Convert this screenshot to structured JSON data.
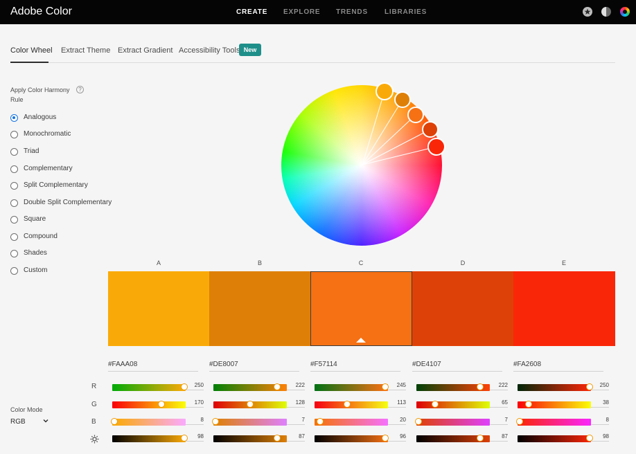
{
  "app": {
    "title": "Adobe Color"
  },
  "nav": {
    "create": "CREATE",
    "explore": "EXPLORE",
    "trends": "TRENDS",
    "libraries": "LIBRARIES"
  },
  "header_icons": [
    "profile-star-icon",
    "contrast-icon",
    "color-wheel-icon"
  ],
  "tabs": [
    {
      "label": "Color Wheel",
      "active": true
    },
    {
      "label": "Extract Theme",
      "active": false
    },
    {
      "label": "Extract Gradient",
      "active": false
    },
    {
      "label": "Accessibility Tools",
      "active": false
    }
  ],
  "new_badge": "New",
  "harmony": {
    "title": "Apply Color Harmony Rule",
    "help": "?",
    "selected": "Analogous",
    "rules": [
      "Analogous",
      "Monochromatic",
      "Triad",
      "Complementary",
      "Split Complementary",
      "Double Split Complementary",
      "Square",
      "Compound",
      "Shades",
      "Custom"
    ]
  },
  "swatches": [
    {
      "letter": "A",
      "hex": "#FAAA08",
      "color": "#faaa08",
      "r": 250,
      "g": 170,
      "b": 8,
      "brightness": 98
    },
    {
      "letter": "B",
      "hex": "#DE8007",
      "color": "#de8007",
      "r": 222,
      "g": 128,
      "b": 7,
      "brightness": 87
    },
    {
      "letter": "C",
      "hex": "#F57114",
      "color": "#f57114",
      "r": 245,
      "g": 113,
      "b": 20,
      "brightness": 96,
      "selected": true
    },
    {
      "letter": "D",
      "hex": "#DE4107",
      "color": "#de4107",
      "r": 222,
      "g": 65,
      "b": 7,
      "brightness": 87
    },
    {
      "letter": "E",
      "hex": "#FA2608",
      "color": "#fa2608",
      "r": 250,
      "g": 38,
      "b": 8,
      "brightness": 98
    }
  ],
  "channels": {
    "r": "R",
    "g": "G",
    "b": "B",
    "brightness_icon": "sun-icon"
  },
  "color_mode": {
    "label": "Color Mode",
    "value": "RGB"
  }
}
